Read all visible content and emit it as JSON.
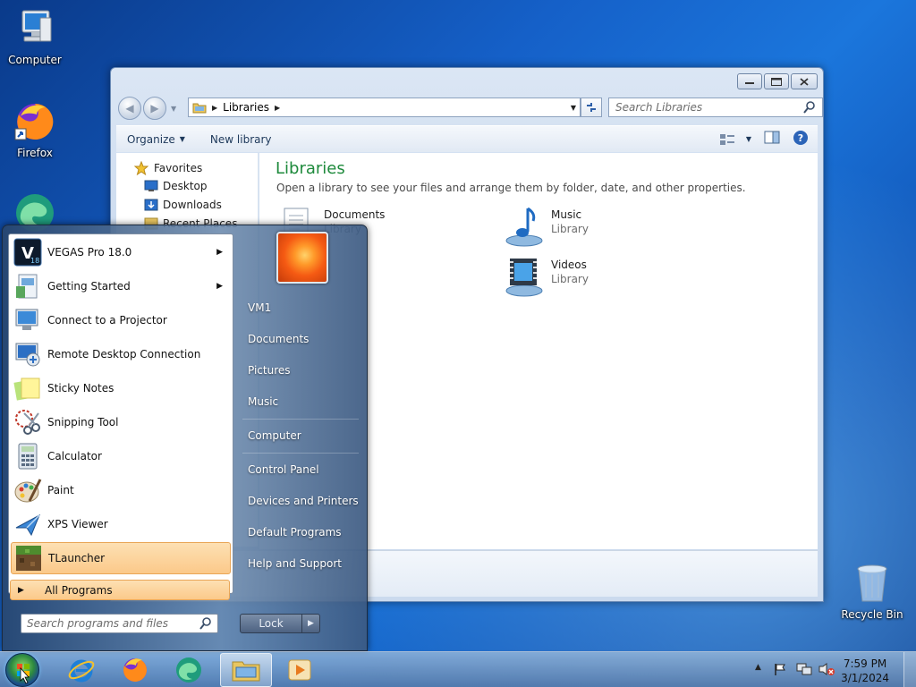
{
  "desktop": {
    "icons": [
      {
        "label": "Computer"
      },
      {
        "label": "Firefox"
      },
      {
        "label": "Recycle Bin"
      }
    ]
  },
  "explorer": {
    "address": {
      "breadcrumb": "Libraries"
    },
    "search": {
      "placeholder": "Search Libraries"
    },
    "commandbar": {
      "organize": "Organize",
      "new_library": "New library"
    },
    "nav": {
      "favorites": "Favorites",
      "desktop": "Desktop",
      "downloads": "Downloads",
      "recent_places": "Recent Places"
    },
    "content": {
      "title": "Libraries",
      "subtitle": "Open a library to see your files and arrange them by folder, date, and other properties.",
      "libraries": [
        {
          "name": "Documents",
          "type": "Library"
        },
        {
          "name": "Music",
          "type": "Library"
        },
        {
          "name": "Videos",
          "type": "Library"
        }
      ]
    }
  },
  "start_menu": {
    "programs": [
      {
        "label": "VEGAS Pro 18.0",
        "has_submenu": true
      },
      {
        "label": "Getting Started",
        "has_submenu": true
      },
      {
        "label": "Connect to a Projector"
      },
      {
        "label": "Remote Desktop Connection"
      },
      {
        "label": "Sticky Notes"
      },
      {
        "label": "Snipping Tool"
      },
      {
        "label": "Calculator"
      },
      {
        "label": "Paint"
      },
      {
        "label": "XPS Viewer"
      },
      {
        "label": "TLauncher",
        "highlighted": true
      }
    ],
    "all_programs": "All Programs",
    "search_placeholder": "Search programs and files",
    "right_links": [
      "VM1",
      "Documents",
      "Pictures",
      "Music",
      "Computer",
      "Control Panel",
      "Devices and Printers",
      "Default Programs",
      "Help and Support"
    ],
    "lock_label": "Lock"
  },
  "taskbar": {
    "clock": {
      "time": "7:59 PM",
      "date": "3/1/2024"
    }
  },
  "colors": {
    "library_title": "#1e8a3c",
    "highlight": "#fbc98a"
  }
}
